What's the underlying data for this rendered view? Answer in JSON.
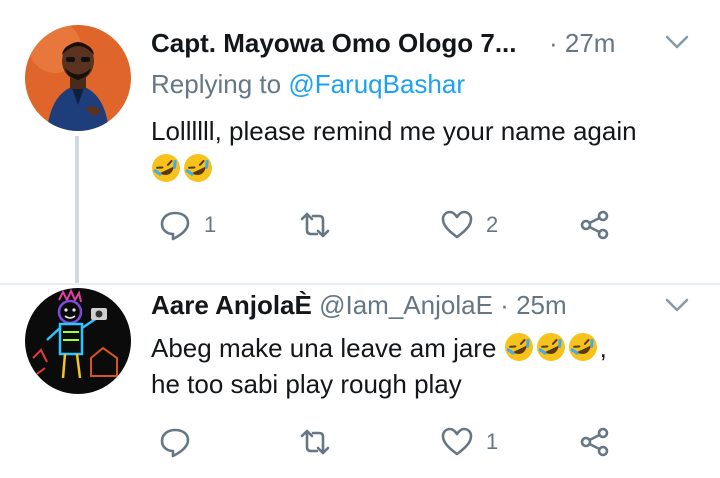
{
  "tweets": [
    {
      "author_name": "Capt. Mayowa Omo Ologo 7...",
      "separator": "·",
      "time": "27m",
      "replying_label": "Replying to",
      "replying_handle": "@FaruqBashar",
      "text_line1": "Lollllll, please remind me your name again",
      "emoji_count": 2,
      "emoji_name": "rolling-on-the-floor-laughing-emoji",
      "actions": {
        "reply_count": "1",
        "retweet_count": "",
        "like_count": "2"
      }
    },
    {
      "author_name": "Aare AnjolaÈ",
      "handle": "@Iam_AnjolaE",
      "separator": "·",
      "time": "25m",
      "text_line1": "Abeg make una leave am jare",
      "text_line1_suffix": ",",
      "text_line2": "he too sabi play rough play",
      "emoji_count": 3,
      "actions": {
        "reply_count": "",
        "retweet_count": "",
        "like_count": "1"
      }
    }
  ],
  "colors": {
    "primary_text": "#14171a",
    "secondary_text": "#657786",
    "link": "#1da1f2",
    "thread_line": "#cfd9de"
  },
  "icons": [
    "reply-icon",
    "retweet-icon",
    "like-icon",
    "share-icon",
    "chevron-down-icon"
  ]
}
